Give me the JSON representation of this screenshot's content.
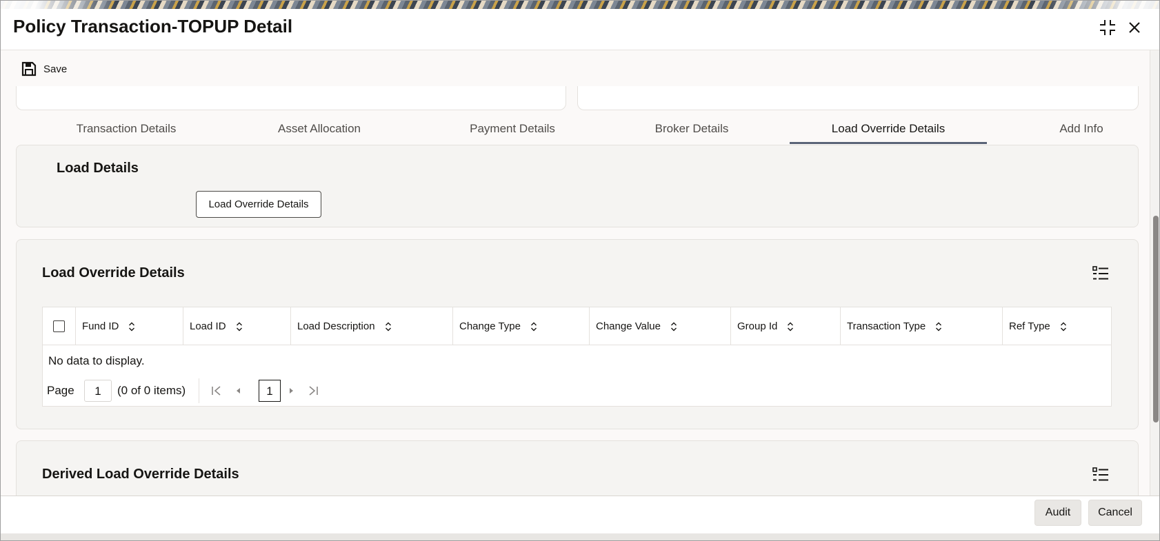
{
  "window": {
    "title": "Policy Transaction-TOPUP Detail"
  },
  "toolbar": {
    "save_label": "Save"
  },
  "tabs": [
    {
      "label": "Transaction Details",
      "active": false
    },
    {
      "label": "Asset Allocation",
      "active": false
    },
    {
      "label": "Payment Details",
      "active": false
    },
    {
      "label": "Broker Details",
      "active": false
    },
    {
      "label": "Load Override Details",
      "active": true
    },
    {
      "label": "Add Info",
      "active": false
    }
  ],
  "load_details": {
    "title": "Load Details",
    "button_label": "Load Override Details"
  },
  "load_override": {
    "title": "Load Override Details",
    "columns": [
      "Fund ID",
      "Load ID",
      "Load Description",
      "Change Type",
      "Change Value",
      "Group Id",
      "Transaction Type",
      "Ref Type"
    ],
    "rows": [],
    "empty_message": "No data to display.",
    "pager": {
      "page_label": "Page",
      "page_value": "1",
      "items_text": "(0 of 0 items)",
      "current_page": "1"
    }
  },
  "derived_load_override": {
    "title": "Derived Load Override Details"
  },
  "footer": {
    "audit_label": "Audit",
    "cancel_label": "Cancel"
  }
}
